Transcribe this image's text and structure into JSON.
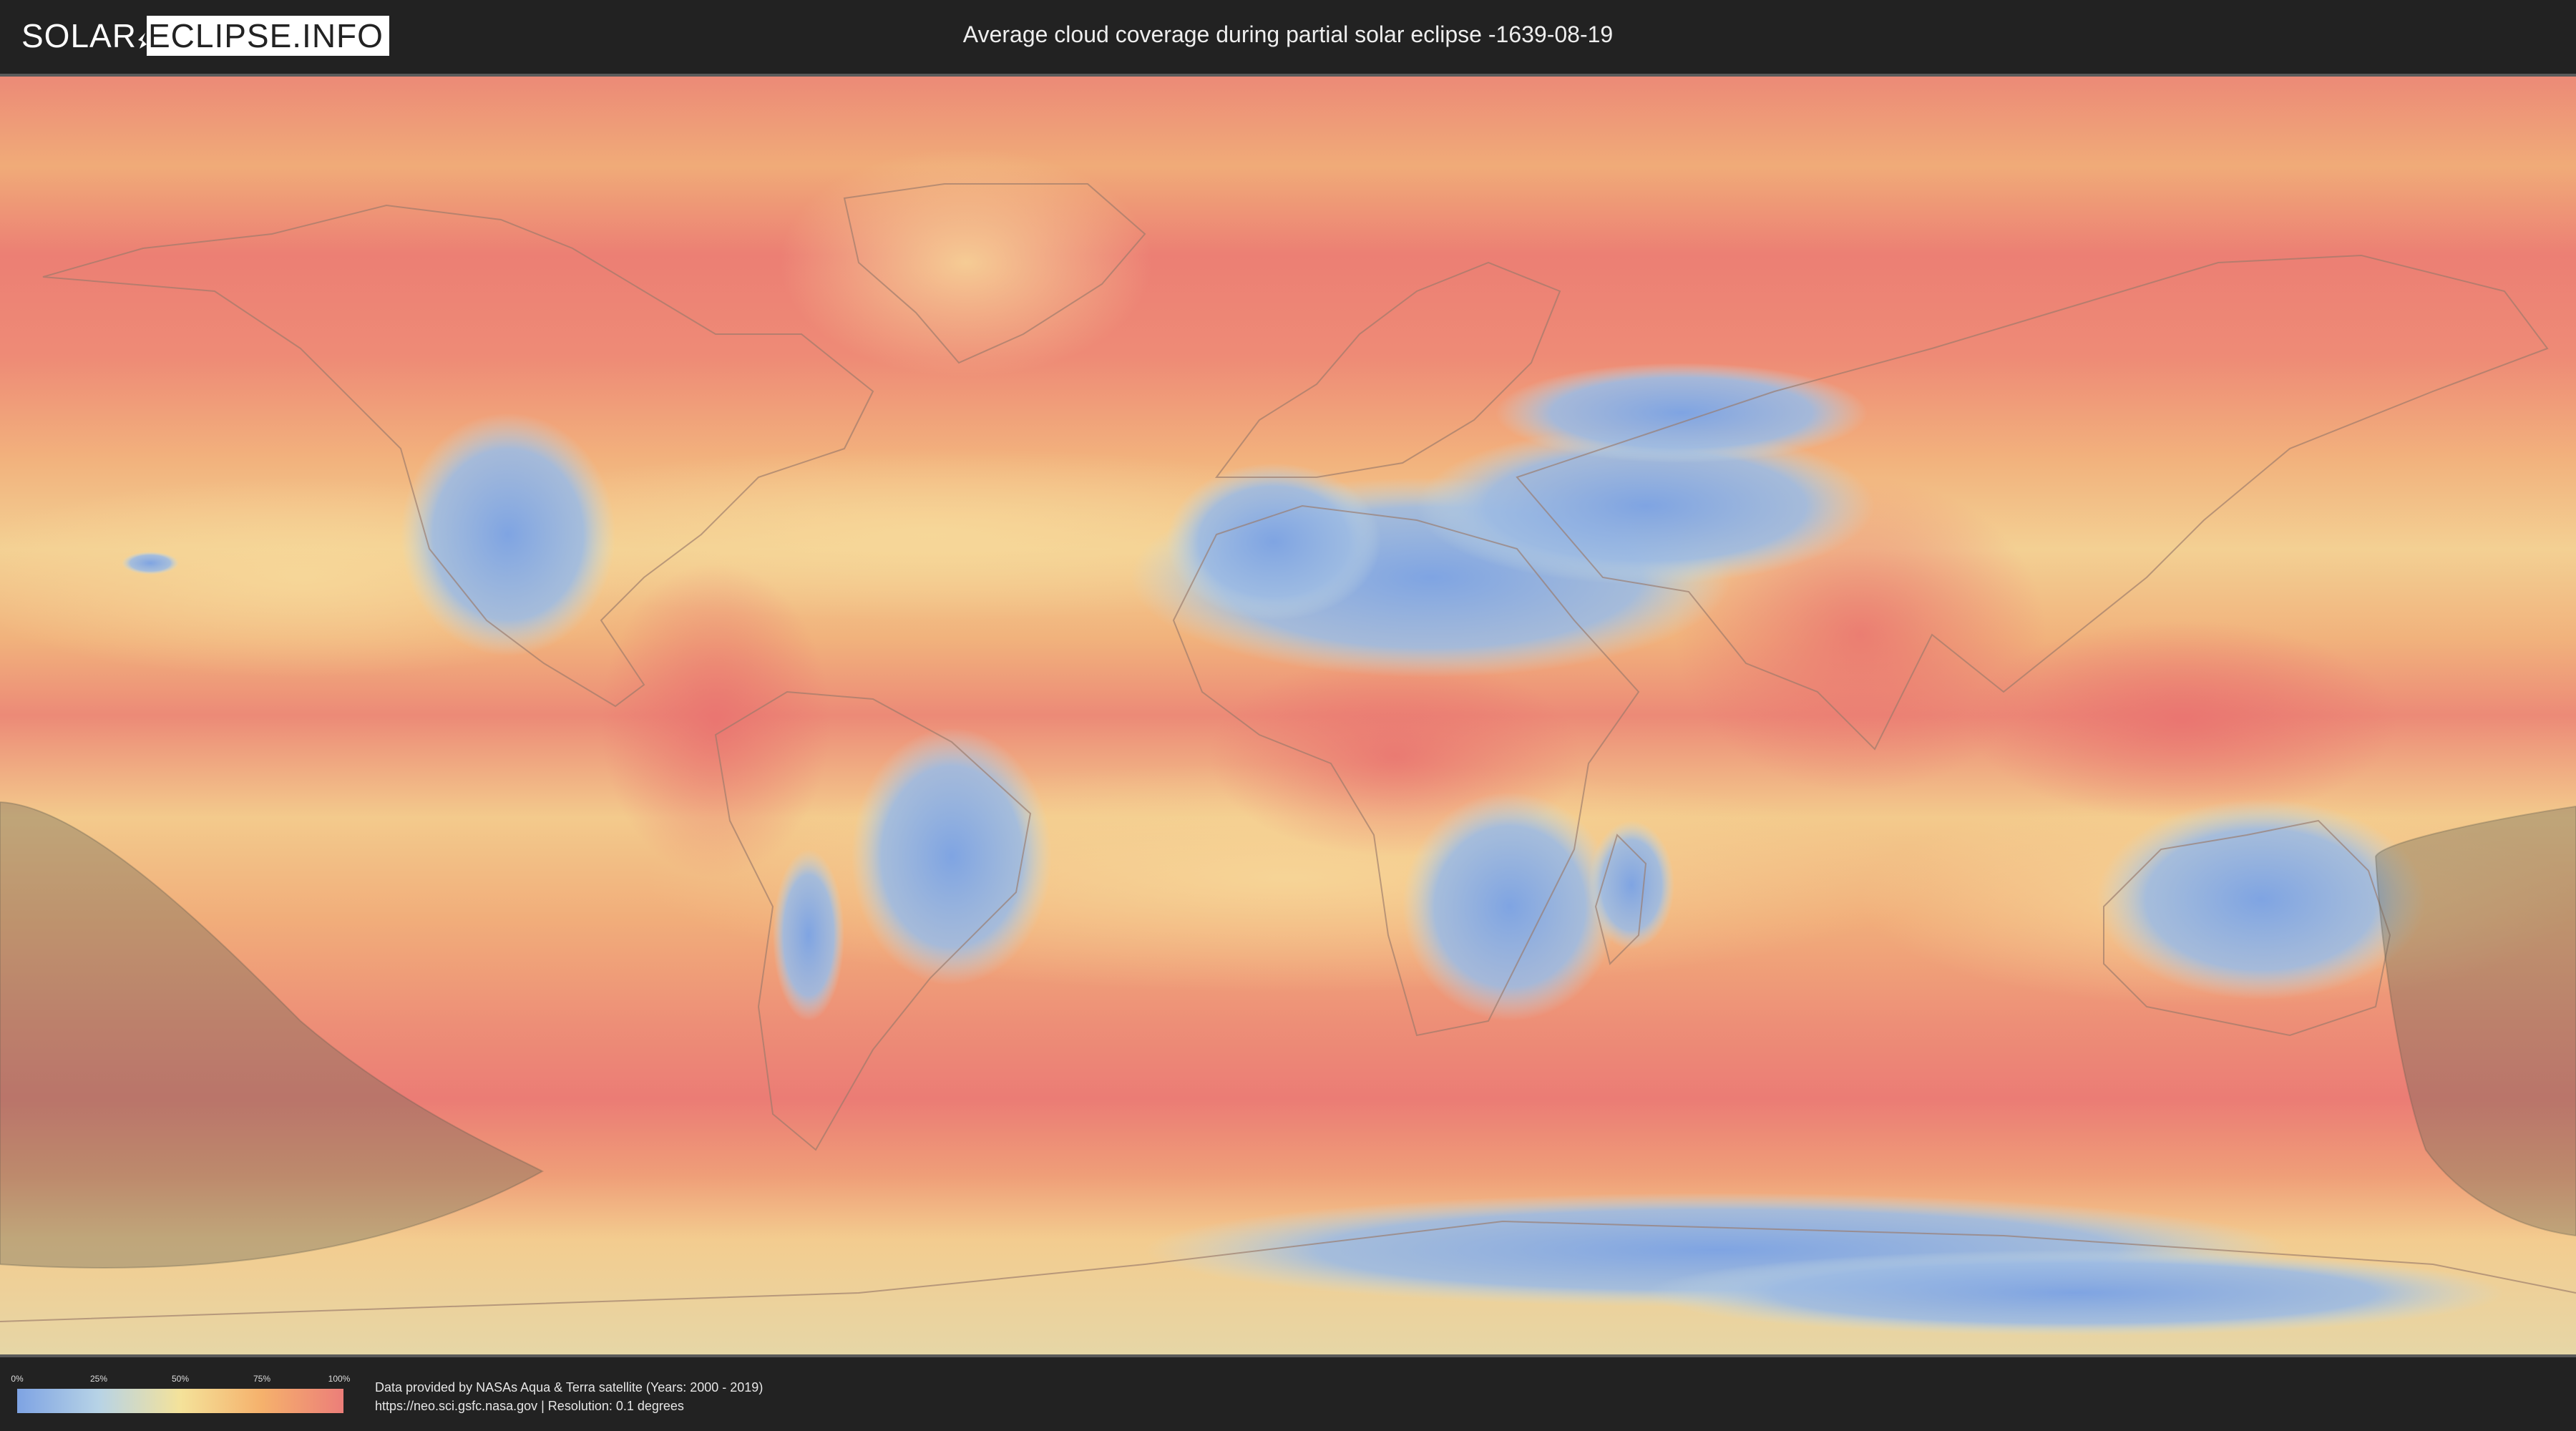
{
  "logo": {
    "left_text": "SOLAR",
    "right_text": "ECLIPSE.INFO"
  },
  "header": {
    "title": "Average cloud coverage during partial solar eclipse -1639-08-19"
  },
  "map": {
    "layer": "average-cloud-coverage",
    "projection": "equirectangular",
    "eclipse_visibility_regions": 2
  },
  "legend": {
    "ticks": [
      "0%",
      "25%",
      "50%",
      "75%",
      "100%"
    ],
    "colors": [
      "#7ea3e3",
      "#b7d3e6",
      "#f4e29a",
      "#f5b16c",
      "#ec7e79"
    ]
  },
  "credits": {
    "line1": "Data provided by NASAs Aqua & Terra satellite (Years: 2000 - 2019)",
    "line2": "https://neo.sci.gsfc.nasa.gov | Resolution: 0.1 degrees"
  }
}
